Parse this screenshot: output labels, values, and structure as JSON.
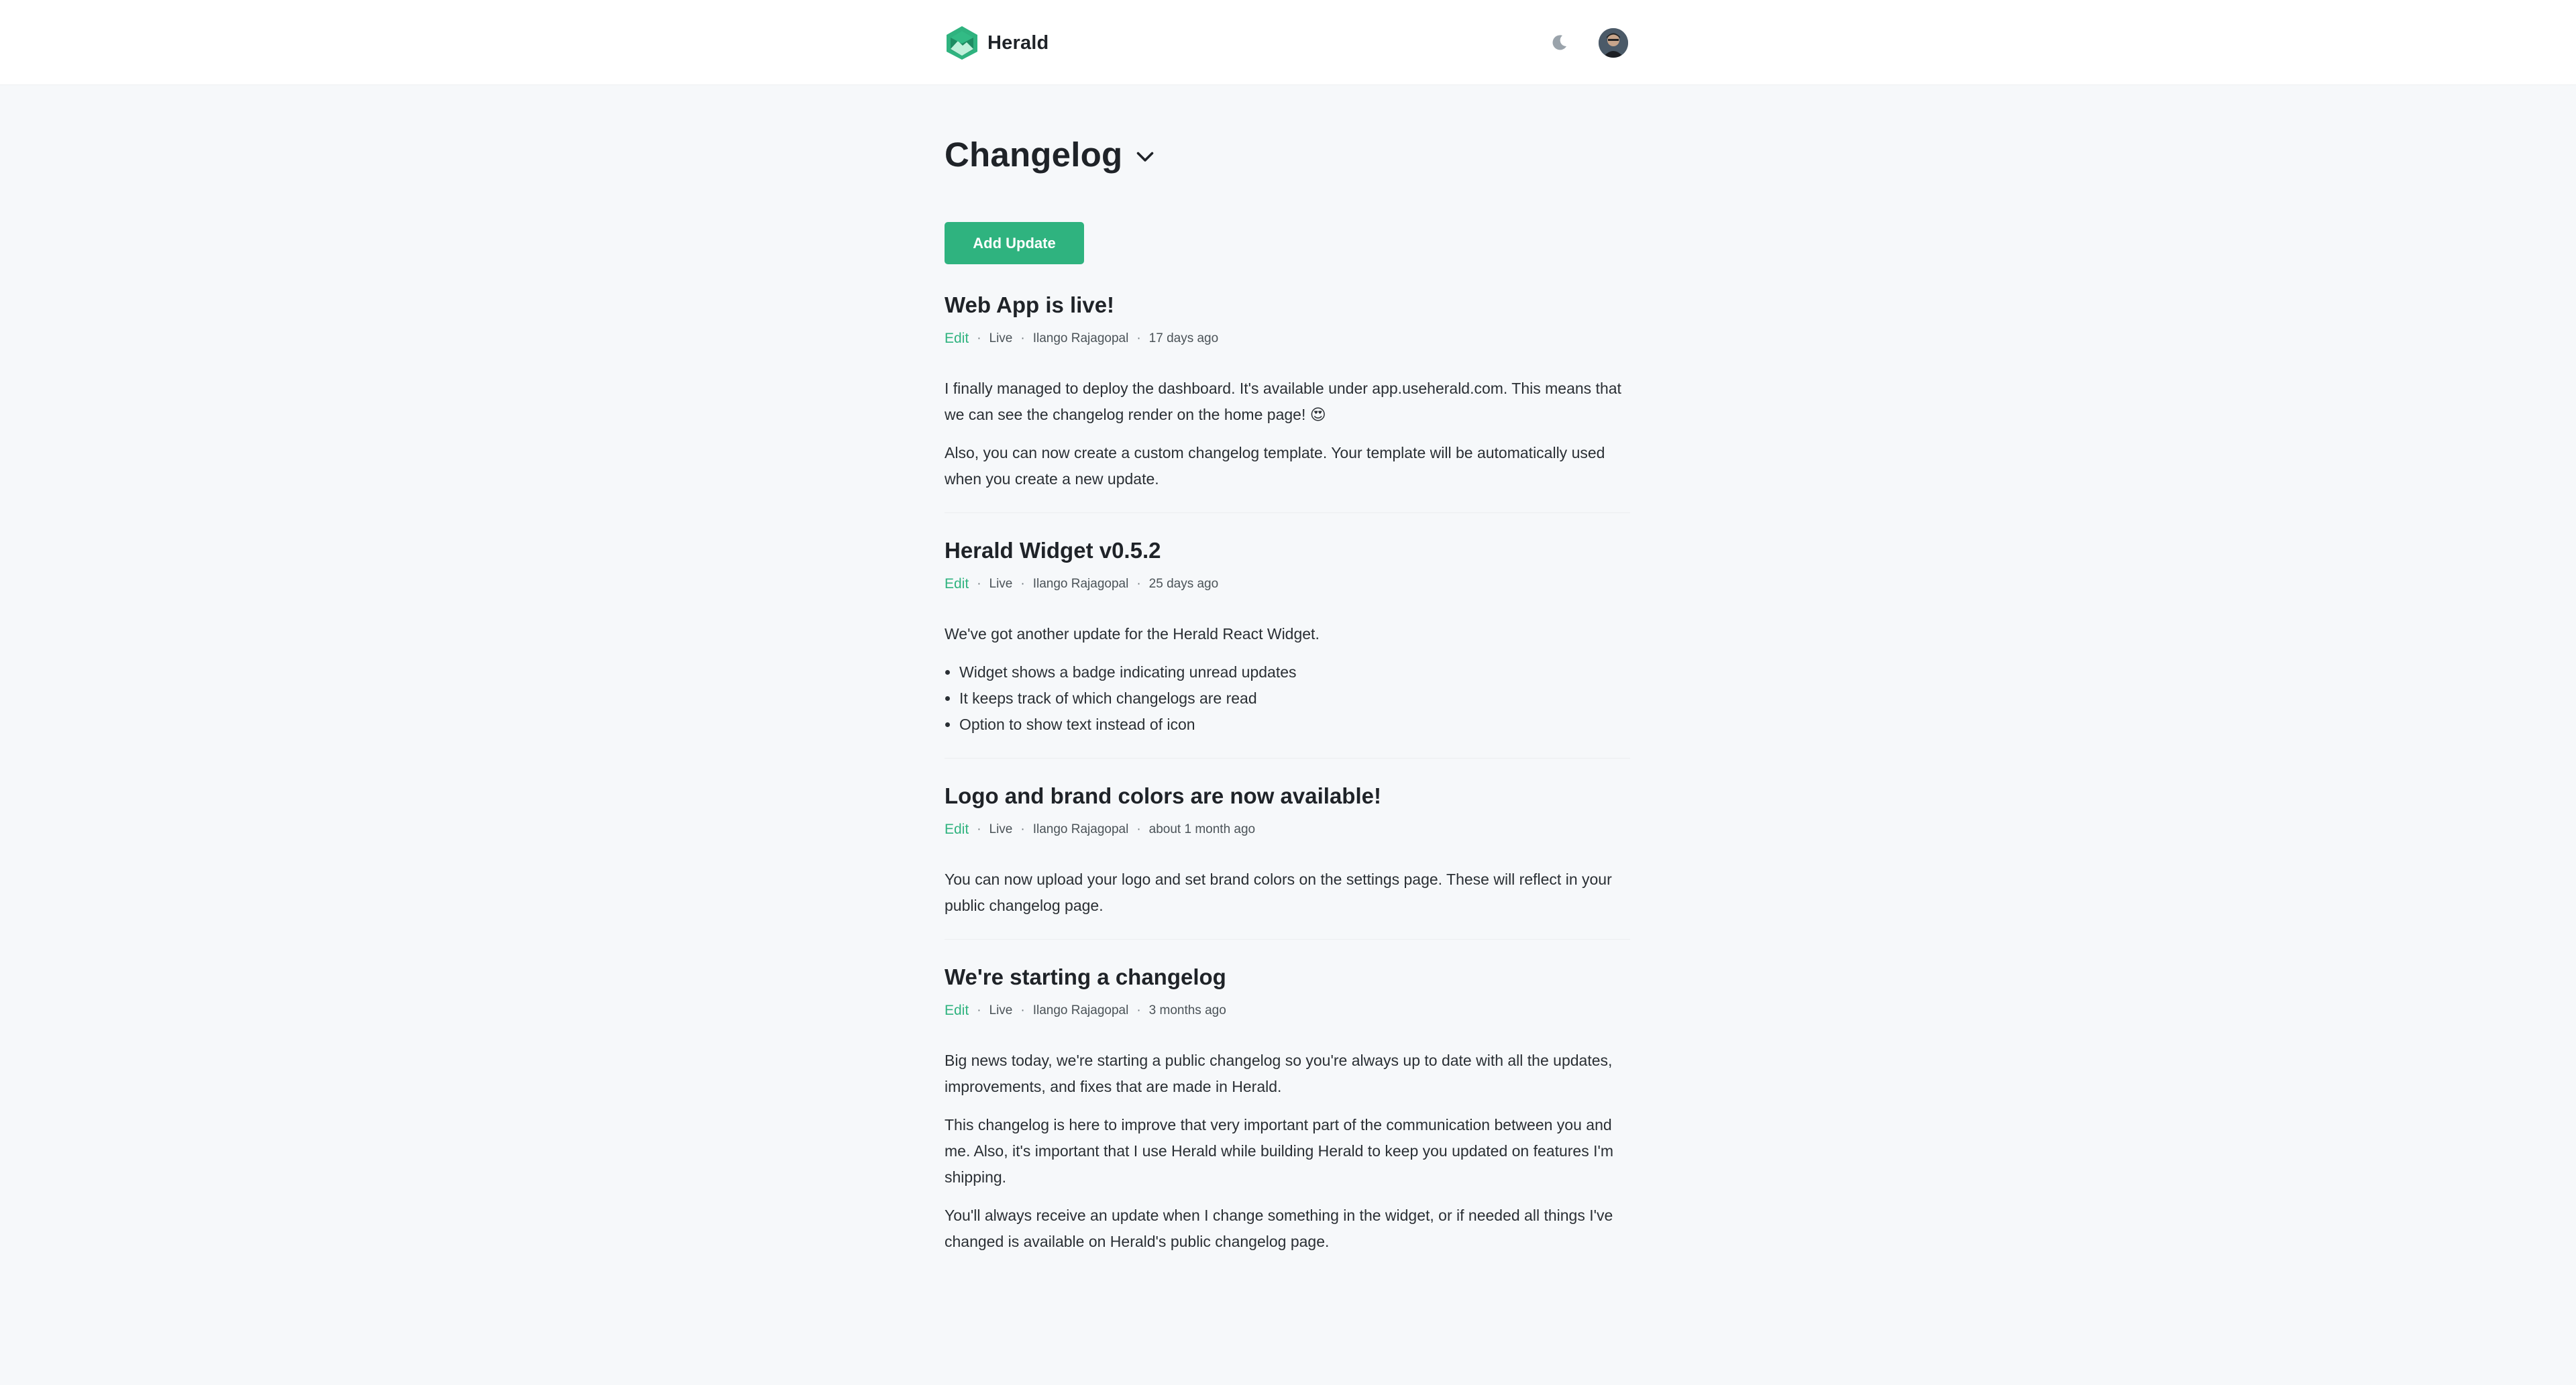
{
  "app": {
    "name": "Herald"
  },
  "header": {
    "theme_toggle_icon": "moon-icon",
    "avatar_alt": "User avatar"
  },
  "page": {
    "title": "Changelog"
  },
  "actions": {
    "add_update_label": "Add Update"
  },
  "colors": {
    "accent": "#2fb37f",
    "background": "#f6f8fa",
    "header_bg": "#ffffff"
  },
  "posts": [
    {
      "title": "Web App is live!",
      "edit_label": "Edit",
      "status": "Live",
      "author": "Ilango Rajagopal",
      "time": "17 days ago",
      "paragraphs": [
        "I finally managed to deploy the dashboard. It's available under app.useherald.com. This means that we can see the changelog render on the home page! 😍",
        "Also, you can now create a custom changelog template. Your template will be automatically used when you create a new update."
      ],
      "bullets": []
    },
    {
      "title": "Herald Widget v0.5.2",
      "edit_label": "Edit",
      "status": "Live",
      "author": "Ilango Rajagopal",
      "time": "25 days ago",
      "paragraphs": [
        "We've got another update for the Herald React Widget."
      ],
      "bullets": [
        "Widget shows a badge indicating unread updates",
        "It keeps track of which changelogs are read",
        "Option to show text instead of icon"
      ]
    },
    {
      "title": "Logo and brand colors are now available!",
      "edit_label": "Edit",
      "status": "Live",
      "author": "Ilango Rajagopal",
      "time": "about 1 month ago",
      "paragraphs": [
        "You can now upload your logo and set brand colors on the settings page. These will reflect in your public changelog page."
      ],
      "bullets": []
    },
    {
      "title": "We're starting a changelog",
      "edit_label": "Edit",
      "status": "Live",
      "author": "Ilango Rajagopal",
      "time": "3 months ago",
      "paragraphs": [
        "Big news today, we're starting a public changelog so you're always up to date with all the updates, improvements, and fixes that are made in Herald.",
        "This changelog is here to improve that very important part of the communication between you and me. Also, it's important that I use Herald while building Herald to keep you updated on features I'm shipping.",
        "You'll always receive an update when I change something in the widget, or if needed all things I've changed is available on Herald's public changelog page."
      ],
      "bullets": []
    }
  ]
}
